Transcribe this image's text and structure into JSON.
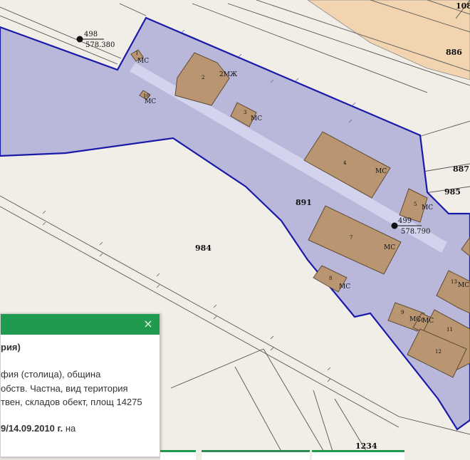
{
  "map": {
    "parcels": [
      {
        "id": "891",
        "name": "891"
      },
      {
        "id": "984",
        "name": "984"
      },
      {
        "id": "886",
        "name": "886"
      },
      {
        "id": "887",
        "name": "887"
      },
      {
        "id": "985",
        "name": "985"
      },
      {
        "id": "1234",
        "name": "1234"
      },
      {
        "id": "108",
        "name": "108"
      }
    ],
    "points": [
      {
        "num": "498",
        "elev": "578.380"
      },
      {
        "num": "499",
        "elev": "578.790"
      }
    ],
    "buildings": [
      {
        "num": "1",
        "type": "МС"
      },
      {
        "num": "2",
        "type": "2МЖ"
      },
      {
        "num": "3",
        "type": "МС"
      },
      {
        "num": "4",
        "type": "МС"
      },
      {
        "num": "5",
        "type": "МС"
      },
      {
        "num": "7",
        "type": "МС"
      },
      {
        "num": "8",
        "type": "МС"
      },
      {
        "num": "9",
        "type": "МС"
      },
      {
        "num": "10",
        "type": "МС"
      },
      {
        "num": "11",
        "type": ""
      },
      {
        "num": "12",
        "type": ""
      },
      {
        "num": "13",
        "type": "МС"
      },
      {
        "num": "10",
        "type": "МС"
      }
    ],
    "colors": {
      "background": "#f1eee8",
      "selected_fill": "#b9b8db",
      "selected_border": "#1a1aa8",
      "building_fill": "#b99671",
      "building_border": "#5e4a33",
      "neighbor_fill": "#f2d4b0",
      "road_stripe": "#d6d6ee"
    }
  },
  "popup": {
    "header_color": "#1f9a4f",
    "close_icon": "×",
    "title": "рия)",
    "lines": [
      "фия (столица), община",
      "обств. Частна, вид територия",
      "твен, складов обект, площ 14275"
    ],
    "date_bold": "9/14.09.2010 г.",
    "date_rest": " на"
  }
}
